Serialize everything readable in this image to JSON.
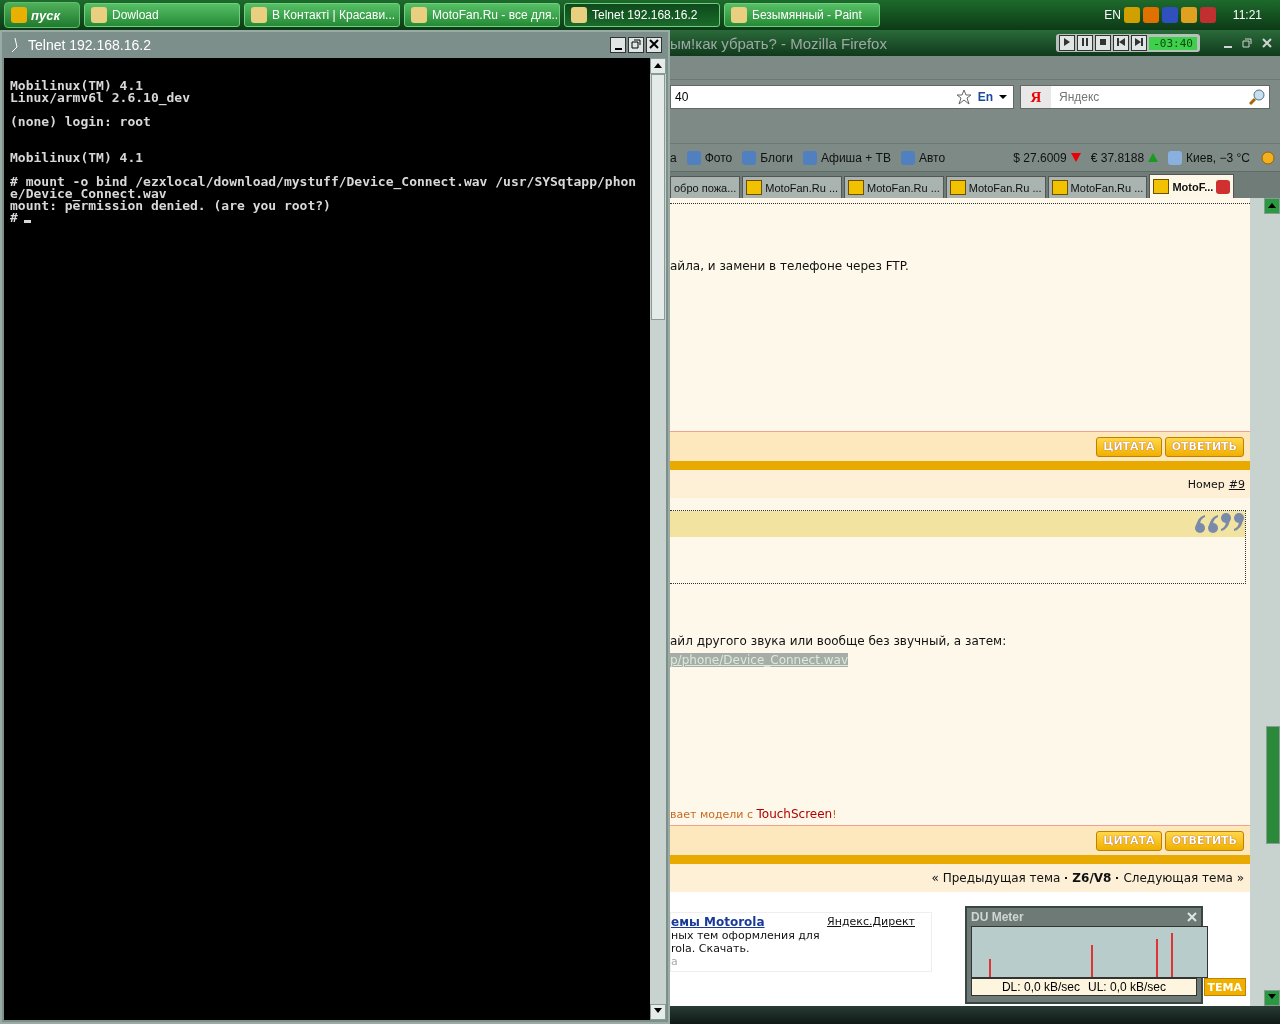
{
  "taskbar": {
    "start": "пуск",
    "tasks": [
      {
        "label": "Dowload",
        "selected": false
      },
      {
        "label": "В Контакті | Красави...",
        "selected": false
      },
      {
        "label": "MotoFan.Ru - все для...",
        "selected": false
      },
      {
        "label": "Telnet 192.168.16.2",
        "selected": true
      },
      {
        "label": "Безымянный - Paint",
        "selected": false
      }
    ],
    "language": "EN",
    "clock": "11:21"
  },
  "telnet": {
    "title": "Telnet 192.168.16.2",
    "blocks": [
      [
        "Mobilinux(TM) 4.1",
        "Linux/armv6l 2.6.10_dev"
      ],
      [
        "(none) login: root"
      ],
      [
        "Mobilinux(TM) 4.1"
      ],
      [
        "# mount -o bind /ezxlocal/download/mystuff/Device_Connect.wav /usr/SYSqtapp/phon",
        "e/Device_Connect.wav",
        "mount: permission denied. (are you root?)",
        "#"
      ]
    ]
  },
  "firefox": {
    "title": "ым!как убрать? - Mozilla Firefox",
    "player_time": "-03:40",
    "url": "40",
    "url_lang": "En",
    "search_logo": "Я",
    "search_placeholder": "Яндекс",
    "yandex_items": [
      "а",
      "Фото",
      "Блоги",
      "Афиша + ТВ",
      "Авто"
    ],
    "rates": [
      {
        "label": "$ 27.6009",
        "kind": "down"
      },
      {
        "label": "€ 37.8188",
        "kind": "up"
      }
    ],
    "weather": "Киев, −3 °C",
    "tabs": [
      {
        "label": "обро пожа...",
        "selected": false
      },
      {
        "label": "MotoFan.Ru ...",
        "selected": false
      },
      {
        "label": "MotoFan.Ru ...",
        "selected": false
      },
      {
        "label": "MotoFan.Ru ...",
        "selected": false
      },
      {
        "label": "MotoFan.Ru ...",
        "selected": false
      },
      {
        "label": "MotoF...",
        "selected": true
      }
    ],
    "post1": {
      "text": "айла, и замени в телефоне через FTP.",
      "buttons": [
        "ЦИТАТА",
        "ОТВЕТИТЬ"
      ]
    },
    "post_number": {
      "label": "Номер",
      "link": "#9"
    },
    "post2": {
      "text": "айл другого звука или вообще без звучный, а затем:",
      "path": "p/phone/Device_Connect.wav",
      "signature": "вает модели с ",
      "signature_link": "TouchScreen",
      "signature_end": "!",
      "buttons": [
        "ЦИТАТА",
        "ОТВЕТИТЬ"
      ]
    },
    "topic_nav": {
      "prev": "« Предыдущая тема",
      "topic": "Z6/V8",
      "next": "Следующая тема »"
    },
    "ad": {
      "title": "емы Motorola",
      "lines": [
        "ных тем оформления для",
        "rola. Скачать."
      ],
      "url": "а",
      "source": "Яндекс.Директ"
    },
    "bottom_button": "ТЕМА"
  },
  "du_meter": {
    "title": "DU Meter",
    "dl": "DL: 0,0 kB/sec",
    "ul": "UL: 0,0 kB/sec"
  }
}
